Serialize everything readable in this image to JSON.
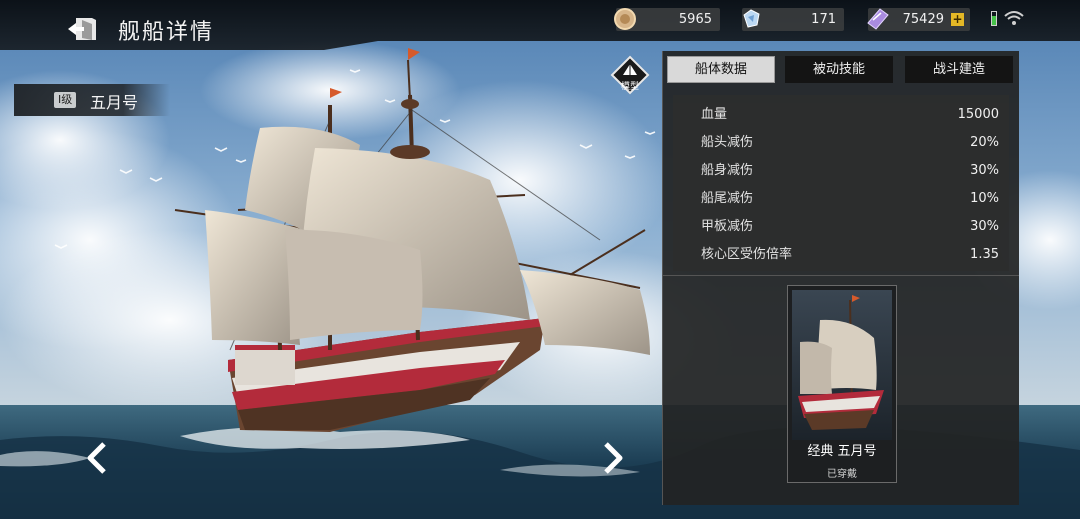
{
  "header": {
    "title": "舰船详情",
    "resources": [
      {
        "name": "gold-coin",
        "icon": "coin-icon",
        "value": "5965"
      },
      {
        "name": "diamond",
        "icon": "diamond-icon",
        "value": "171"
      },
      {
        "name": "ticket",
        "icon": "ticket-icon",
        "value": "75429"
      }
    ],
    "add_label": "+",
    "battery_color": "#46c24a"
  },
  "ship": {
    "level": "Ⅰ级",
    "name": "五月号"
  },
  "model_button": {
    "label": "模型"
  },
  "tabs": [
    {
      "label": "船体数据",
      "active": true
    },
    {
      "label": "被动技能",
      "active": false
    },
    {
      "label": "战斗建造",
      "active": false
    }
  ],
  "stats": [
    {
      "label": "血量",
      "value": "15000"
    },
    {
      "label": "船头减伤",
      "value": "20%"
    },
    {
      "label": "船身减伤",
      "value": "30%"
    },
    {
      "label": "船尾减伤",
      "value": "10%"
    },
    {
      "label": "甲板减伤",
      "value": "30%"
    },
    {
      "label": "核心区受伤倍率",
      "value": "1.35"
    }
  ],
  "skin_card": {
    "name": "经典 五月号",
    "status": "已穿戴"
  },
  "colors": {
    "accent_gold": "#e5b826",
    "panel_bg": "#222324",
    "tab_active": "#d9d9d9"
  }
}
